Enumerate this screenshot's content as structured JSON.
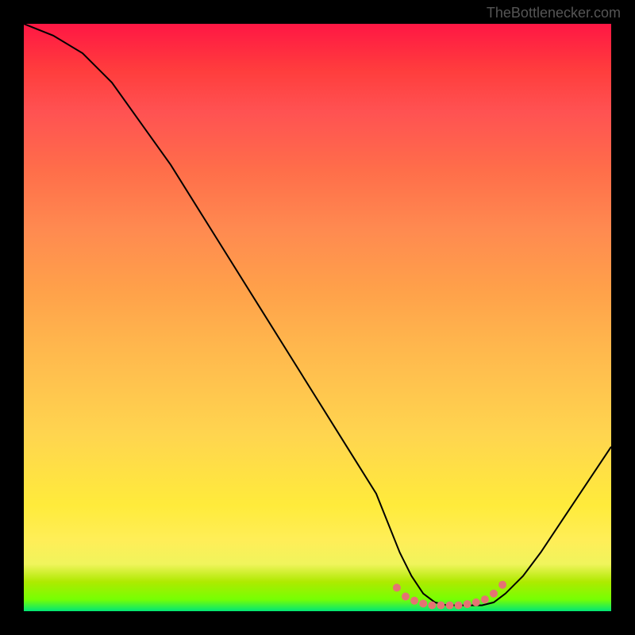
{
  "watermark": "TheBottlenecker.com",
  "chart_data": {
    "type": "line",
    "title": "",
    "xlabel": "",
    "ylabel": "",
    "xlim": [
      0,
      100
    ],
    "ylim": [
      0,
      100
    ],
    "series": [
      {
        "name": "bottleneck-curve",
        "x": [
          0,
          5,
          10,
          15,
          20,
          25,
          30,
          35,
          40,
          45,
          50,
          55,
          60,
          62,
          64,
          66,
          68,
          70,
          72,
          74,
          76,
          78,
          80,
          82,
          85,
          88,
          92,
          96,
          100
        ],
        "y": [
          100,
          98,
          95,
          90,
          83,
          76,
          68,
          60,
          52,
          44,
          36,
          28,
          20,
          15,
          10,
          6,
          3,
          1.5,
          1,
          1,
          1,
          1,
          1.5,
          3,
          6,
          10,
          16,
          22,
          28
        ]
      },
      {
        "name": "optimal-range-dots",
        "x": [
          63.5,
          65,
          66.5,
          68,
          69.5,
          71,
          72.5,
          74,
          75.5,
          77,
          78.5,
          80,
          81.5
        ],
        "y": [
          4,
          2.5,
          1.8,
          1.3,
          1,
          1,
          1,
          1,
          1.2,
          1.5,
          2,
          3,
          4.5
        ]
      }
    ],
    "colors": {
      "curve": "#000000",
      "dots": "#e57373",
      "gradient_top": "#ff1744",
      "gradient_bottom": "#00e676"
    }
  }
}
